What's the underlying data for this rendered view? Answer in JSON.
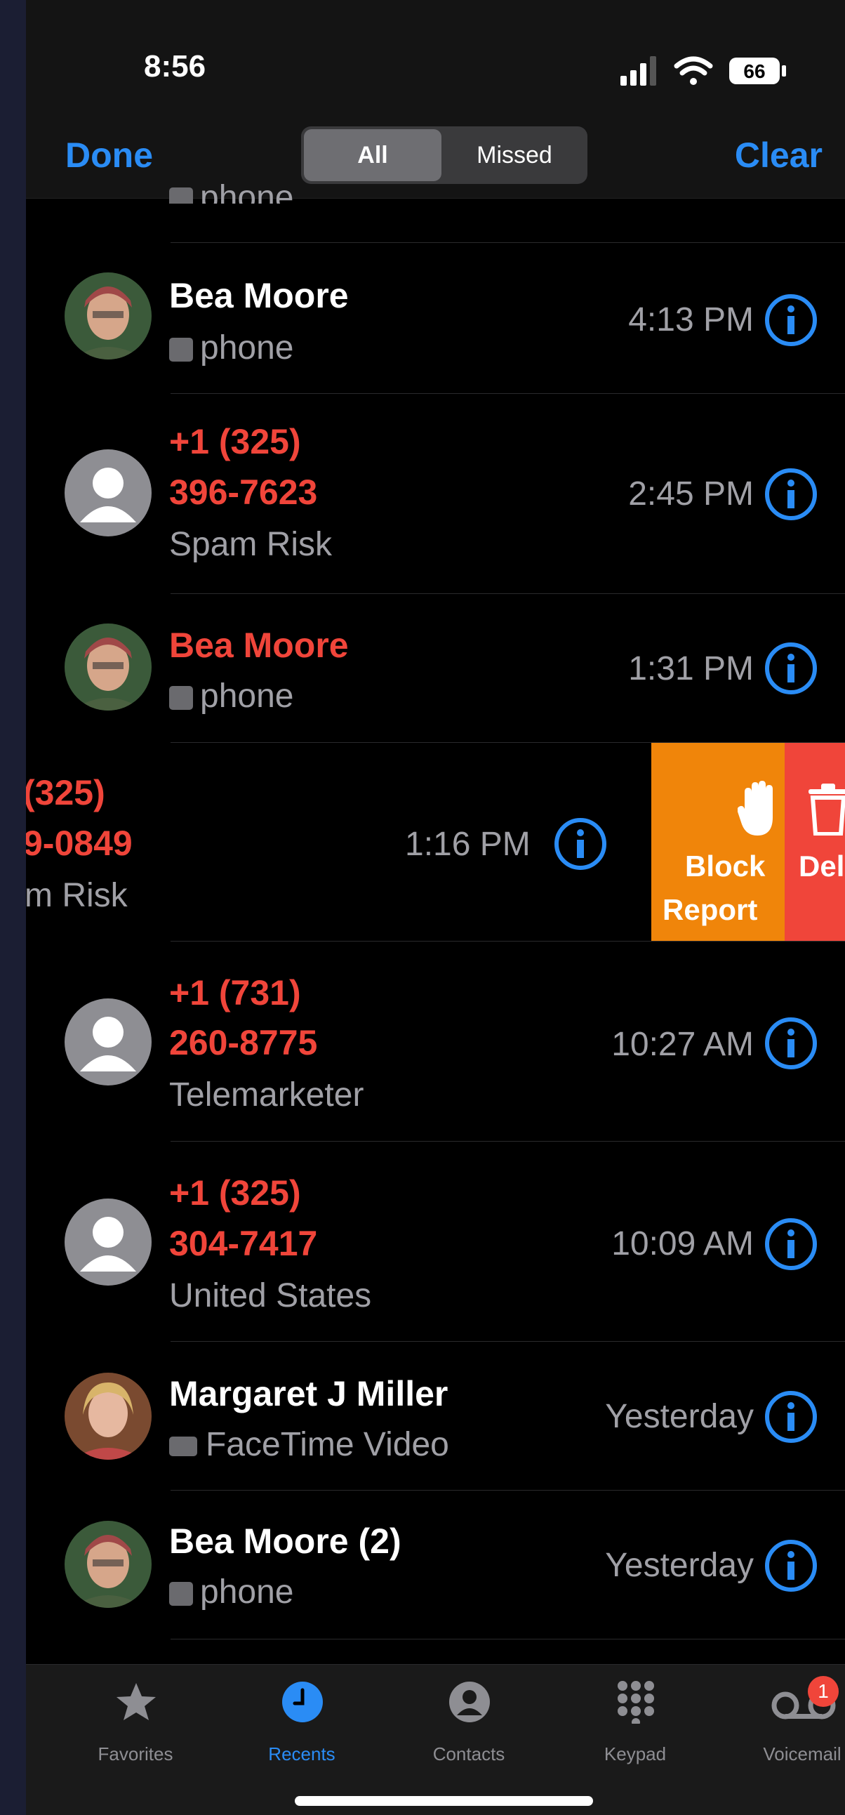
{
  "status": {
    "time": "8:56",
    "battery": "66"
  },
  "nav": {
    "done": "Done",
    "clear": "Clear",
    "segments": [
      "All",
      "Missed"
    ]
  },
  "partial_row": {
    "sub": "phone"
  },
  "calls": [
    {
      "name": "Bea Moore",
      "name_color": "white",
      "sub": "phone",
      "time": "4:13 PM",
      "avatar": "bea-photo"
    },
    {
      "name_line1": "+1 (325)",
      "name_line2": "396-7623",
      "name_color": "red",
      "sub": "Spam Risk",
      "time": "2:45 PM",
      "avatar": "placeholder"
    },
    {
      "name": "Bea Moore",
      "name_color": "red",
      "sub": "phone",
      "time": "1:31 PM",
      "avatar": "bea-photo"
    },
    {
      "name_line1": "(325)",
      "name_line2": "9-0849",
      "name_color": "red",
      "sub": "m Risk",
      "time": "1:16 PM",
      "avatar": "none",
      "swiped": true
    },
    {
      "name_line1": "+1 (731)",
      "name_line2": "260-8775",
      "name_color": "red",
      "sub": "Telemarketer",
      "time": "10:27 AM",
      "avatar": "placeholder"
    },
    {
      "name_line1": "+1 (325)",
      "name_line2": "304-7417",
      "name_color": "red",
      "sub": "United States",
      "time": "10:09 AM",
      "avatar": "placeholder"
    },
    {
      "name": "Margaret J Miller",
      "name_color": "white",
      "sub": "FaceTime Video",
      "time": "Yesterday",
      "avatar": "margaret-photo"
    },
    {
      "name": "Bea Moore (2)",
      "name_color": "white",
      "sub": "phone",
      "time": "Yesterday",
      "avatar": "bea-photo"
    }
  ],
  "swipe_actions": {
    "block_line1": "Block",
    "block_line2": "Report",
    "delete": "Del"
  },
  "tabs": [
    {
      "label": "Favorites",
      "icon": "star-icon"
    },
    {
      "label": "Recents",
      "icon": "clock-icon",
      "active": true
    },
    {
      "label": "Contacts",
      "icon": "person-circle-icon"
    },
    {
      "label": "Keypad",
      "icon": "keypad-icon"
    },
    {
      "label": "Voicemail",
      "icon": "voicemail-icon",
      "badge": "1"
    }
  ],
  "colors": {
    "accent": "#2a8cf5",
    "missed": "#f0453a",
    "block": "#f0850a",
    "delete": "#f0453a"
  }
}
